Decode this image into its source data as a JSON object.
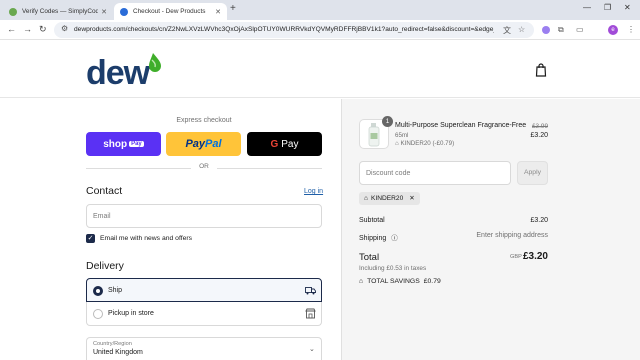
{
  "browser": {
    "tabs": [
      {
        "title": "Verify Codes — SimplyCodes",
        "active": false,
        "favicon_color": "#6aa84f"
      },
      {
        "title": "Checkout - Dew Products",
        "active": true,
        "favicon_color": "#2a6cd8"
      }
    ],
    "new_tab": "+",
    "url": "dewproducts.com/checkouts/cn/Z2NwLXVzLWVhc3QxOjAxSlpOTUY0WURRVkdYQVMyRDFFRjBBV1k1?auto_redirect=false&discount=&edge_red...",
    "nav_icons": [
      "back-icon",
      "forward-icon",
      "reload-icon"
    ],
    "profile_initial": "e"
  },
  "header": {
    "logo_text": "dew",
    "logo_colors": {
      "text": "#1c3d6b",
      "drop": "#3fae2a"
    },
    "cart_icon": "shopping-bag-icon"
  },
  "checkout": {
    "express_label": "Express checkout",
    "shop_pay": {
      "main": "shop",
      "badge": "Pay"
    },
    "paypal": {
      "part1": "Pay",
      "part2": "Pal"
    },
    "gpay": {
      "g": "G",
      "label": "Pay"
    },
    "or_label": "OR",
    "contact": {
      "title": "Contact",
      "login_label": "Log in",
      "email_placeholder": "Email",
      "newsletter_label": "Email me with news and offers",
      "newsletter_checked": true
    },
    "delivery": {
      "title": "Delivery",
      "options": [
        {
          "label": "Ship",
          "selected": true,
          "icon": "truck-icon"
        },
        {
          "label": "Pickup in store",
          "selected": false,
          "icon": "store-icon"
        }
      ],
      "country_label": "Country/Region",
      "country_value": "United Kingdom"
    }
  },
  "summary": {
    "item": {
      "quantity": "1",
      "name": "Multi-Purpose Superclean Fragrance-Free",
      "variant": "65ml",
      "discount": "KINDER20 (-£0.79)",
      "price_old": "£3.99",
      "price_new": "£3.20"
    },
    "discount_placeholder": "Discount code",
    "apply_label": "Apply",
    "applied_code": "KINDER20",
    "subtotal_label": "Subtotal",
    "subtotal_value": "£3.20",
    "shipping_label": "Shipping",
    "shipping_value": "Enter shipping address",
    "total_label": "Total",
    "total_currency": "GBP",
    "total_value": "£3.20",
    "taxes_note": "Including £0.53 in taxes",
    "savings_label": "TOTAL SAVINGS",
    "savings_value": "£0.79"
  }
}
